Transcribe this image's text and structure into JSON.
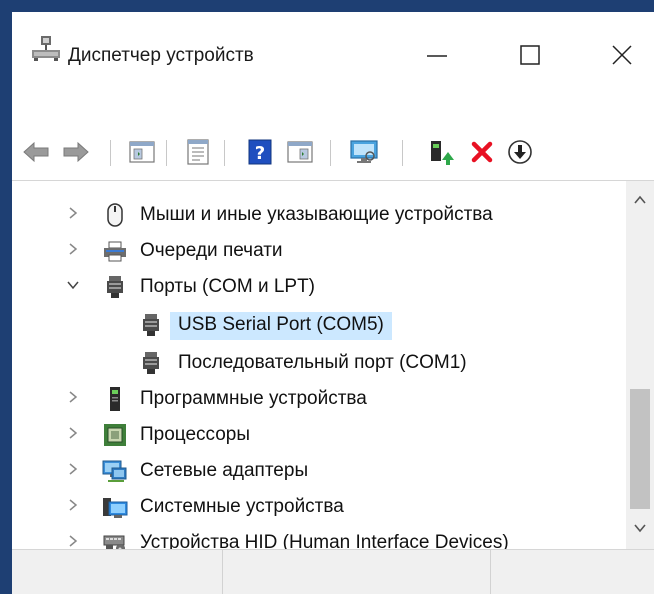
{
  "window": {
    "title": "Диспетчер устройств"
  },
  "toolbar": {
    "buttons": [
      {
        "name": "back-button",
        "icon": "arrow-left-icon"
      },
      {
        "name": "forward-button",
        "icon": "arrow-right-icon"
      },
      {
        "name": "show-hide-console-tree-button",
        "icon": "console-tree-icon"
      },
      {
        "name": "properties-button",
        "icon": "properties-icon"
      },
      {
        "name": "help-button",
        "icon": "help-icon",
        "glyph": "?"
      },
      {
        "name": "action-pane-button",
        "icon": "action-pane-icon"
      },
      {
        "name": "scan-hardware-button",
        "icon": "monitor-scan-icon"
      },
      {
        "name": "update-driver-button",
        "icon": "update-driver-icon"
      },
      {
        "name": "uninstall-device-button",
        "icon": "red-x-icon"
      },
      {
        "name": "disable-device-button",
        "icon": "download-circle-icon"
      }
    ]
  },
  "tree": {
    "items": [
      {
        "label": "Мыши и иные указывающие устройства",
        "expanded": false,
        "icon": "mouse-icon",
        "level": 0
      },
      {
        "label": "Очереди печати",
        "expanded": false,
        "icon": "printer-icon",
        "level": 0
      },
      {
        "label": "Порты (COM и LPT)",
        "expanded": true,
        "icon": "port-icon",
        "level": 0
      },
      {
        "label": "USB Serial Port (COM5)",
        "icon": "port-icon",
        "level": 1,
        "selected": true
      },
      {
        "label": "Последовательный порт (COM1)",
        "icon": "port-icon",
        "level": 1
      },
      {
        "label": "Программные устройства",
        "expanded": false,
        "icon": "software-device-icon",
        "level": 0
      },
      {
        "label": "Процессоры",
        "expanded": false,
        "icon": "processor-icon",
        "level": 0
      },
      {
        "label": "Сетевые адаптеры",
        "expanded": false,
        "icon": "network-adapter-icon",
        "level": 0
      },
      {
        "label": "Системные устройства",
        "expanded": false,
        "icon": "system-device-icon",
        "level": 0
      },
      {
        "label": "Устройства HID (Human Interface Devices)",
        "expanded": false,
        "icon": "hid-icon",
        "level": 0
      }
    ]
  },
  "colors": {
    "selection": "#cce8ff",
    "desktop": "#1e3f73",
    "uninstall_red": "#e81123",
    "help_blue": "#1f4fbf"
  }
}
